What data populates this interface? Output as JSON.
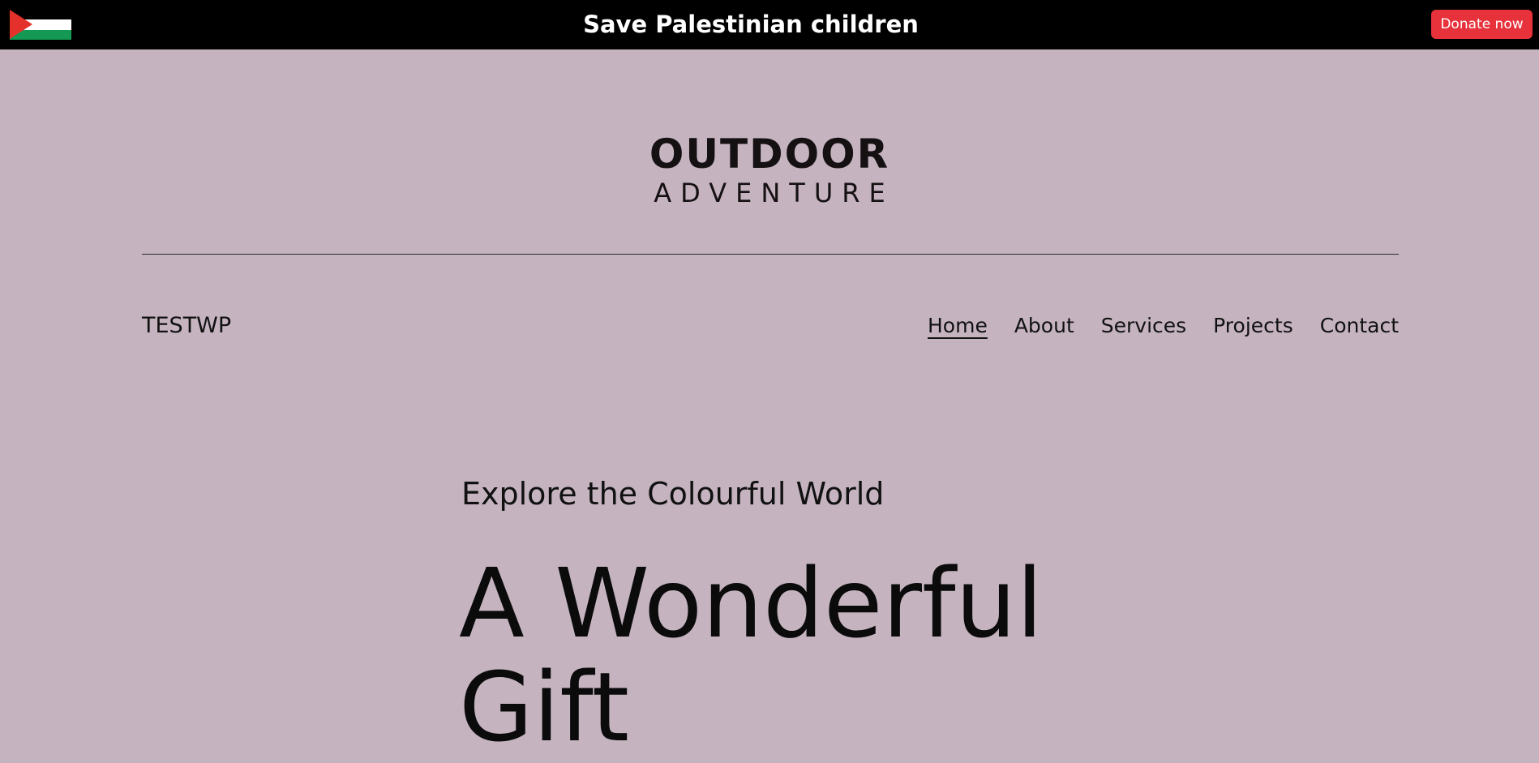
{
  "banner": {
    "title": "Save Palestinian children",
    "donate_label": "Donate now",
    "flag_icon": "palestine-flag-icon",
    "colors": {
      "background": "#000000",
      "donate": "#e7323c"
    }
  },
  "logo": {
    "main": "OUTDOOR",
    "sub": "ADVENTURE"
  },
  "header": {
    "site_title": "TESTWP",
    "nav": [
      {
        "label": "Home",
        "active": true
      },
      {
        "label": "About",
        "active": false
      },
      {
        "label": "Services",
        "active": false
      },
      {
        "label": "Projects",
        "active": false
      },
      {
        "label": "Contact",
        "active": false
      }
    ]
  },
  "hero": {
    "eyebrow": "Explore the Colourful World",
    "heading": "A Wonderful Gift"
  },
  "colors": {
    "page_background": "#c5b4c0"
  }
}
